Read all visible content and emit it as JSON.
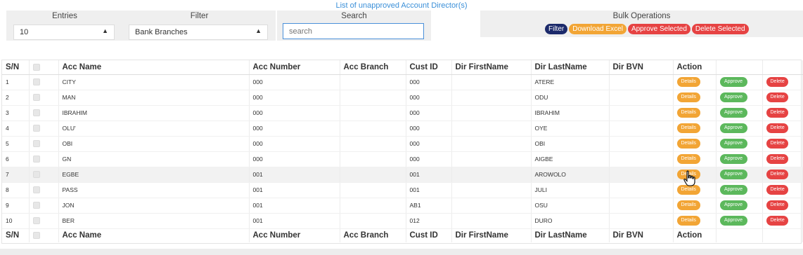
{
  "page_title": "List of unapproved Account Director(s)",
  "entries": {
    "label": "Entries",
    "value": "10"
  },
  "filter": {
    "label": "Filter",
    "value": "Bank Branches"
  },
  "search": {
    "label": "Search",
    "placeholder": "search"
  },
  "bulk": {
    "label": "Bulk Operations",
    "buttons": [
      "Filter",
      "Download Excel",
      "Approve Selected",
      "Delete Selected"
    ]
  },
  "table": {
    "headers": [
      "S/N",
      "",
      "Acc Name",
      "Acc Number",
      "Acc Branch",
      "Cust ID",
      "Dir FirstName",
      "Dir LastName",
      "Dir BVN",
      "Action",
      "",
      ""
    ],
    "action_labels": {
      "details": "Details",
      "approve": "Approve",
      "delete": "Delete"
    },
    "rows": [
      {
        "sn": "1",
        "acc_name": "CITY",
        "acc_number": "000",
        "acc_branch": "",
        "cust_id": "000",
        "dir_first": "",
        "dir_last": "ATERE",
        "dir_bvn": ""
      },
      {
        "sn": "2",
        "acc_name": "MAN",
        "acc_number": "000",
        "acc_branch": "",
        "cust_id": "000",
        "dir_first": "",
        "dir_last": "ODU",
        "dir_bvn": ""
      },
      {
        "sn": "3",
        "acc_name": "IBRAHIM",
        "acc_number": "000",
        "acc_branch": "",
        "cust_id": "000",
        "dir_first": "",
        "dir_last": "IBRAHIM",
        "dir_bvn": ""
      },
      {
        "sn": "4",
        "acc_name": "OLU'",
        "acc_number": "000",
        "acc_branch": "",
        "cust_id": "000",
        "dir_first": "",
        "dir_last": "OYE",
        "dir_bvn": ""
      },
      {
        "sn": "5",
        "acc_name": "OBI",
        "acc_number": "000",
        "acc_branch": "",
        "cust_id": "000",
        "dir_first": "",
        "dir_last": "OBI",
        "dir_bvn": ""
      },
      {
        "sn": "6",
        "acc_name": "GN",
        "acc_number": "000",
        "acc_branch": "",
        "cust_id": "000",
        "dir_first": "",
        "dir_last": "AIGBE",
        "dir_bvn": ""
      },
      {
        "sn": "7",
        "acc_name": "EGBE",
        "acc_number": "001",
        "acc_branch": "",
        "cust_id": "001",
        "dir_first": "",
        "dir_last": "AROWOLO",
        "dir_bvn": ""
      },
      {
        "sn": "8",
        "acc_name": "PASS",
        "acc_number": "001",
        "acc_branch": "",
        "cust_id": "001",
        "dir_first": "",
        "dir_last": "JULI",
        "dir_bvn": ""
      },
      {
        "sn": "9",
        "acc_name": "JON",
        "acc_number": "001",
        "acc_branch": "",
        "cust_id": "AB1",
        "dir_first": "",
        "dir_last": "OSU",
        "dir_bvn": ""
      },
      {
        "sn": "10",
        "acc_name": "BER",
        "acc_number": "001",
        "acc_branch": "",
        "cust_id": "012",
        "dir_first": "",
        "dir_last": "DURO",
        "dir_bvn": ""
      }
    ],
    "highlighted_row": 7
  }
}
